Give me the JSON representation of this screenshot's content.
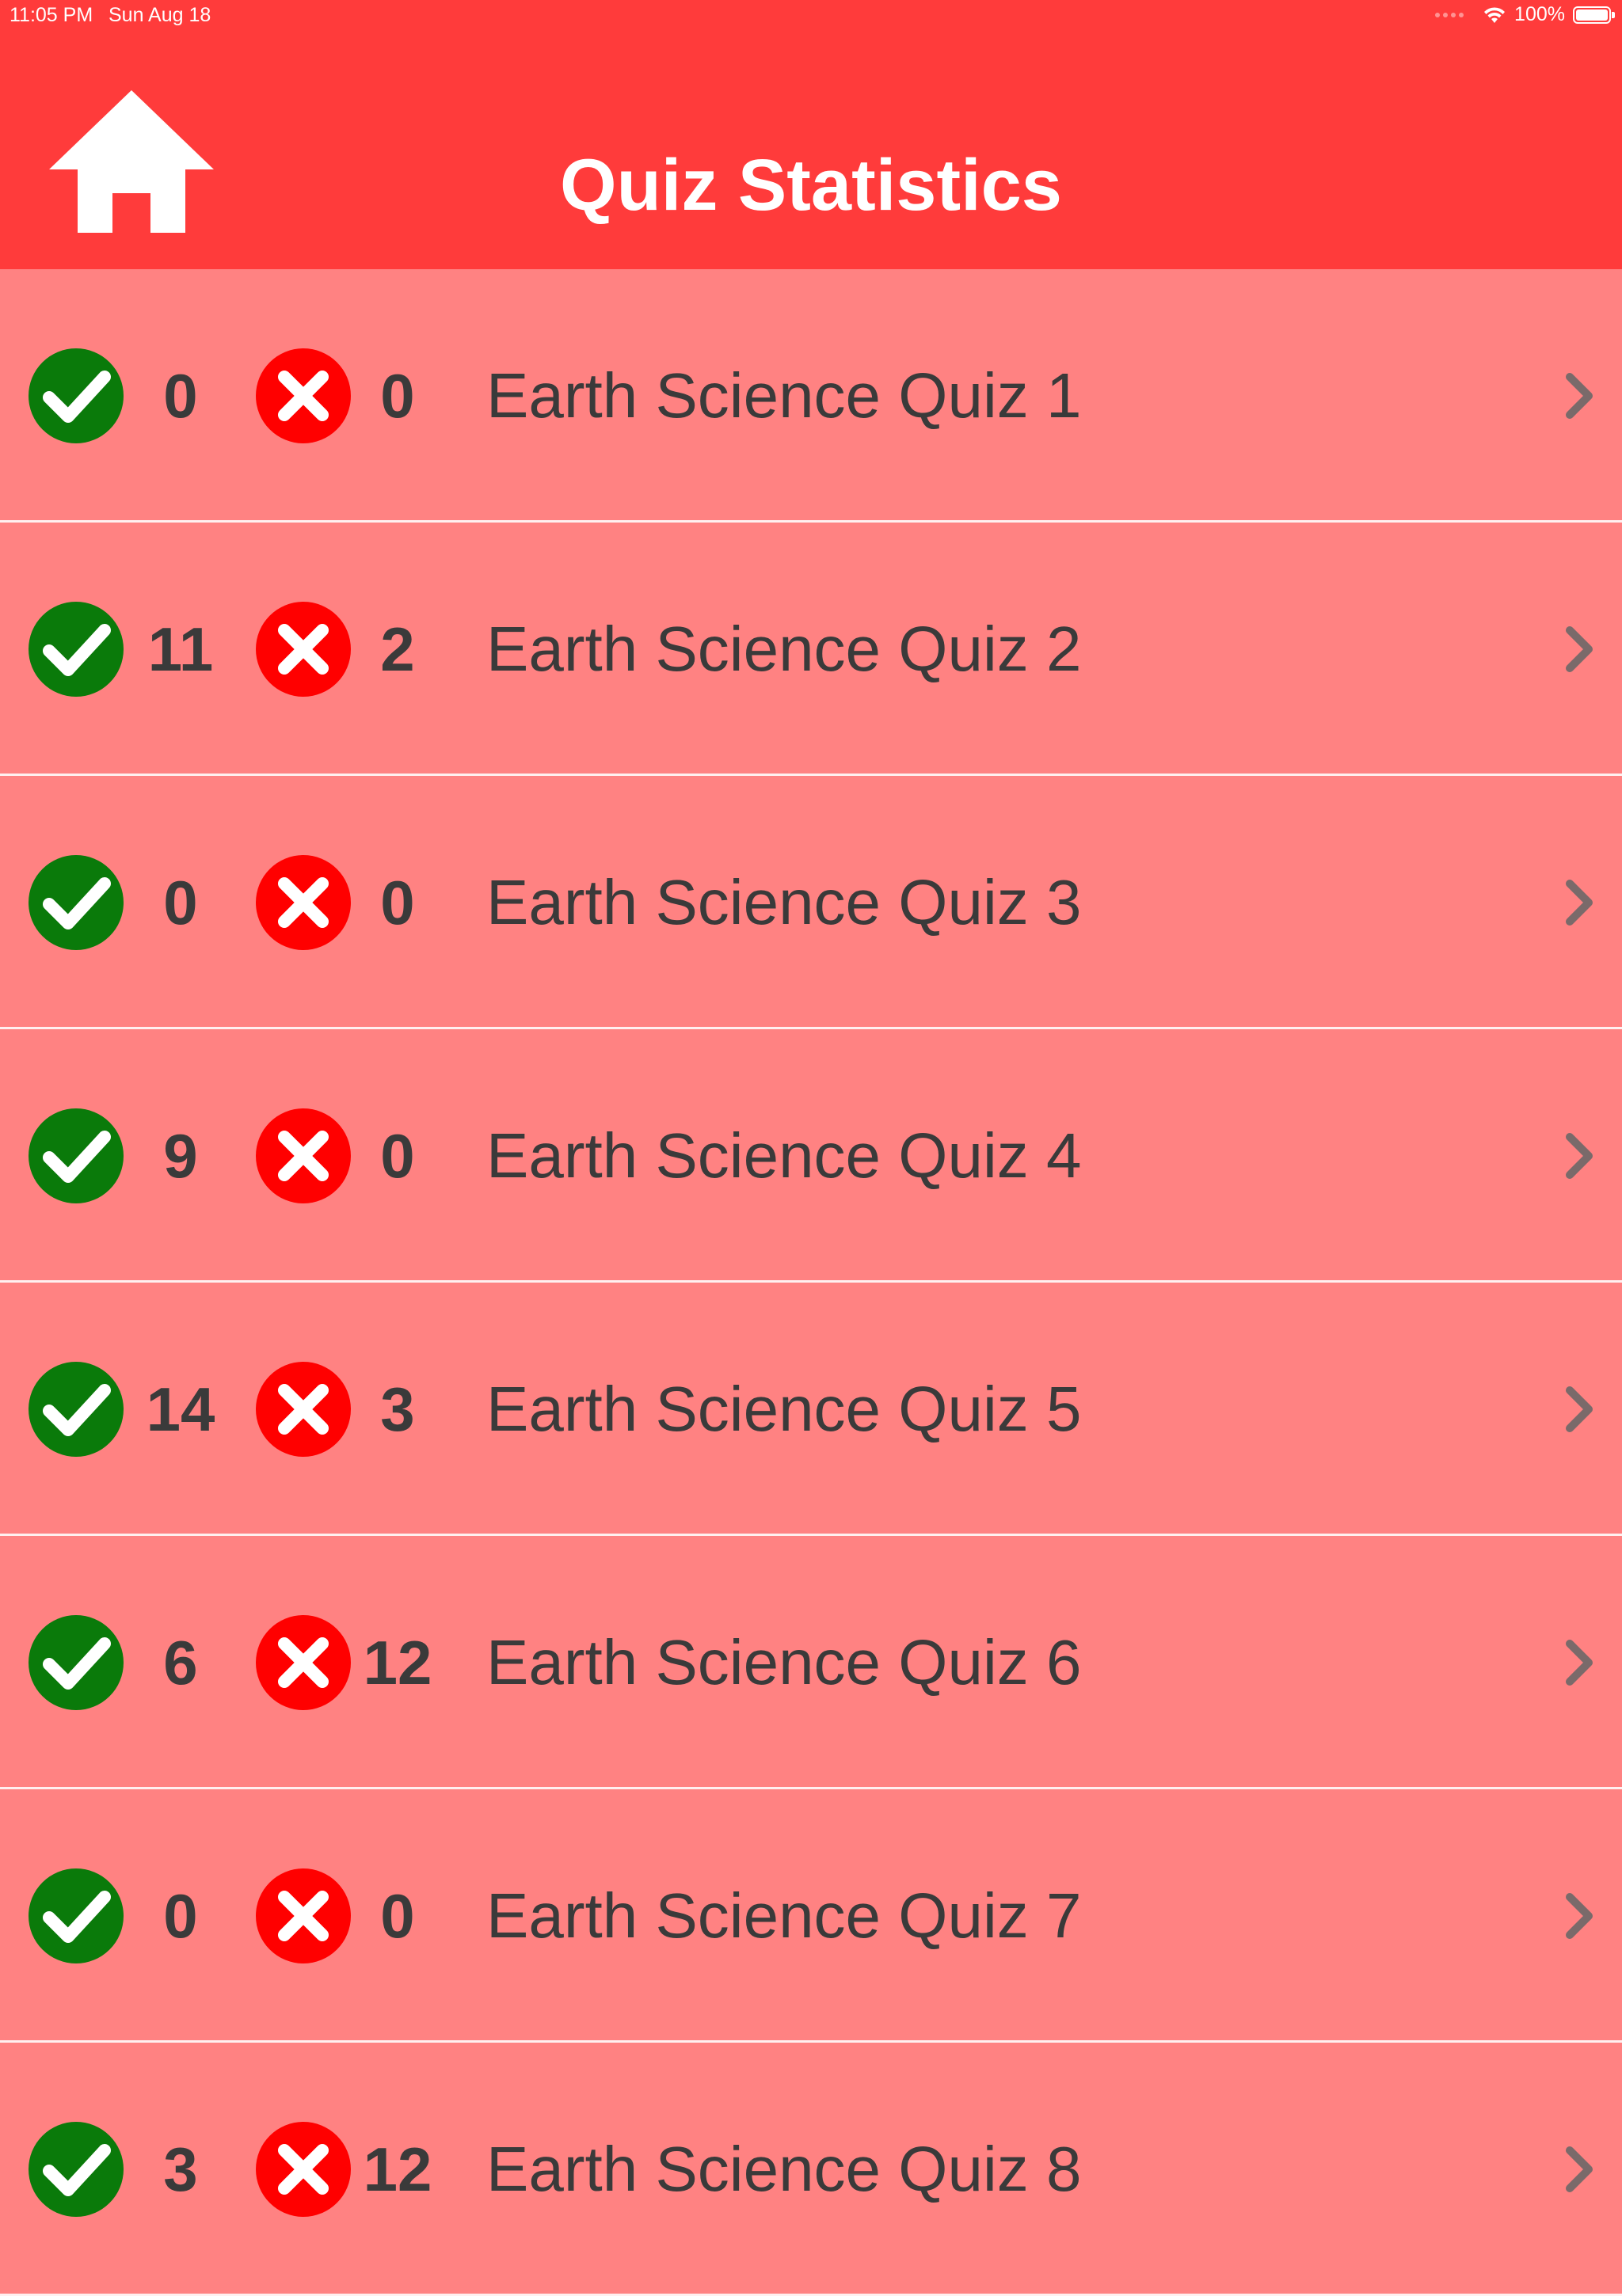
{
  "status_bar": {
    "time": "11:05 PM",
    "date": "Sun Aug 18",
    "battery": "100%"
  },
  "nav": {
    "title": "Quiz Statistics",
    "home_icon": "home-icon"
  },
  "colors": {
    "header": "#ff3b3b",
    "row_background": "#ff8282",
    "correct": "#0a7a0a",
    "wrong": "#ff0000",
    "text": "#3a3a3a"
  },
  "quizzes": [
    {
      "name": "Earth Science Quiz 1",
      "correct": "0",
      "wrong": "0"
    },
    {
      "name": "Earth Science Quiz 2",
      "correct": "11",
      "wrong": "2"
    },
    {
      "name": "Earth Science Quiz 3",
      "correct": "0",
      "wrong": "0"
    },
    {
      "name": "Earth Science Quiz 4",
      "correct": "9",
      "wrong": "0"
    },
    {
      "name": "Earth Science Quiz 5",
      "correct": "14",
      "wrong": "3"
    },
    {
      "name": "Earth Science Quiz 6",
      "correct": "6",
      "wrong": "12"
    },
    {
      "name": "Earth Science Quiz 7",
      "correct": "0",
      "wrong": "0"
    },
    {
      "name": "Earth Science Quiz 8",
      "correct": "3",
      "wrong": "12"
    }
  ]
}
